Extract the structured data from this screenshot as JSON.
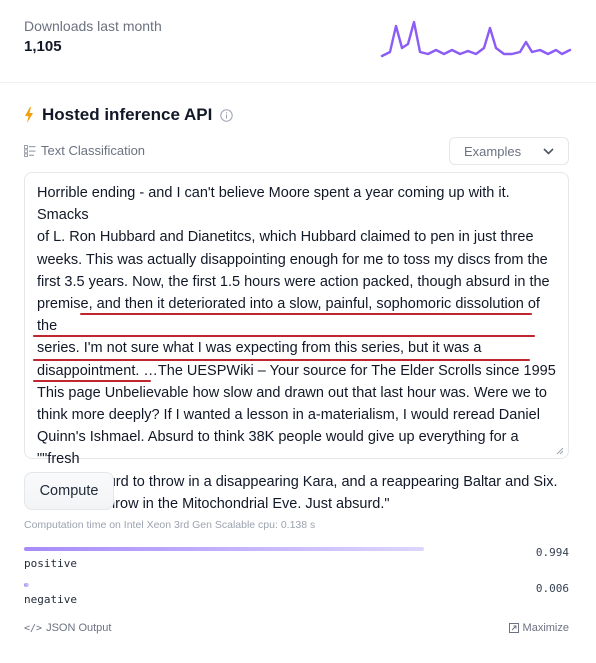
{
  "downloads": {
    "label": "Downloads last month",
    "value": "1,105"
  },
  "sparkline": {
    "color": "#8b5cf6"
  },
  "api": {
    "title": "Hosted inference API",
    "icon": "lightning-icon",
    "icon_color": "#f59e0b"
  },
  "task": {
    "label": "Text Classification",
    "icon": "text-classification-icon"
  },
  "examples": {
    "label": "Examples"
  },
  "input": {
    "lines": [
      "Horrible ending - and I can't believe Moore spent a year coming up with it. Smacks",
      "of L. Ron Hubbard and Dianetitcs, which Hubbard claimed to pen in just three",
      "weeks. This was actually disappointing enough for me to toss my discs from the",
      "first 3.5 years. Now, the first 1.5 hours were action packed, though absurd in the",
      "premise, and then it deteriorated into a slow, painful, sophomoric dissolution of the",
      "series. I'm not sure what I was expecting from this series, but it was a",
      "disappointment.  …The UESPWiki – Your source for The Elder Scrolls since 1995",
      "This page Unbelievable how slow and drawn out that last hour was. Were we to",
      "think more deeply? If I wanted a lesson in a-materialism, I would reread Daniel",
      "Quinn's Ishmael. Absurd to think 38K people would give up everything for a \"\"fresh",
      "start\"\". Absurd to throw in a disappearing Kara, and a reappearing Baltar and Six.",
      "Absurd to throw in the Mitochondrial Eve. Just absurd.\""
    ],
    "underline_color": "#c0262d"
  },
  "compute": {
    "label": "Compute"
  },
  "computation_time": "Computation time on Intel Xeon 3rd Gen Scalable cpu: 0.138 s",
  "results": [
    {
      "label": "positive",
      "score": "0.994",
      "fraction": 0.994
    },
    {
      "label": "negative",
      "score": "0.006",
      "fraction": 0.006
    }
  ],
  "footer": {
    "json_output": "JSON Output",
    "maximize": "Maximize"
  }
}
